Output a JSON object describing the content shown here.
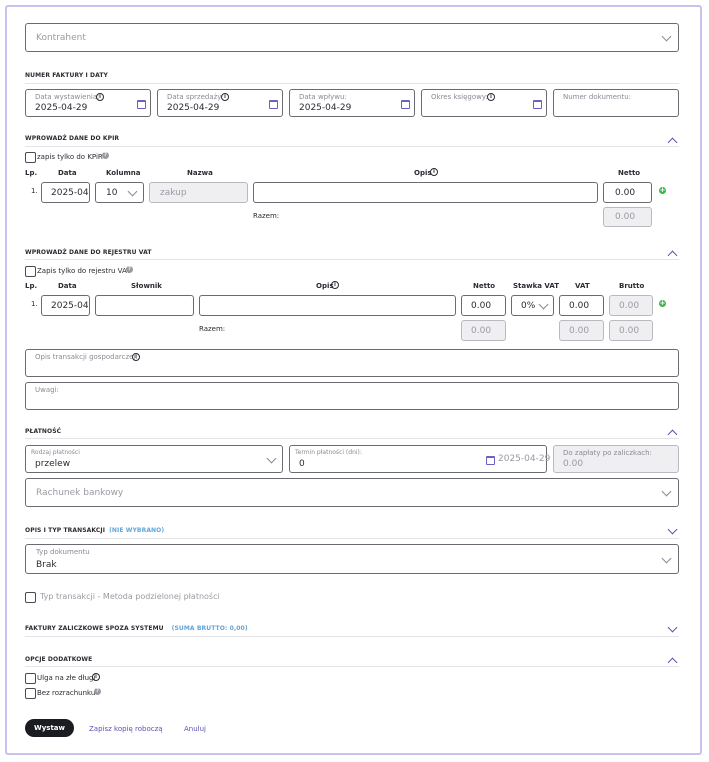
{
  "kontrahent": {
    "placeholder": "Kontrahent"
  },
  "faktura": {
    "section_title": "NUMER FAKTURY I DATY",
    "data_wystawienia": {
      "label": "Data wystawienia:",
      "value": "2025-04-29"
    },
    "data_sprzedazy": {
      "label": "Data sprzedaży:",
      "value": "2025-04-29"
    },
    "data_wplywu": {
      "label": "Data wpływu:",
      "value": "2025-04-29"
    },
    "okres_ksiegowy": {
      "label": "Okres księgowy:",
      "value": ""
    },
    "numer_dokumentu": {
      "label": "Numer dokumentu:",
      "value": ""
    }
  },
  "kpir": {
    "section_title": "WPROWADŹ DANE DO KPIR",
    "checkbox_label": "zapis tylko do KPiR",
    "headers": {
      "lp": "Lp.",
      "data": "Data",
      "kolumna": "Kolumna",
      "nazwa": "Nazwa",
      "opis": "Opis",
      "netto": "Netto"
    },
    "row": {
      "lp": "1.",
      "data": "2025-04",
      "kolumna": "10",
      "nazwa": "zakup",
      "opis": "",
      "netto": "0.00"
    },
    "razem_label": "Razem:",
    "razem_netto": "0.00"
  },
  "vat": {
    "section_title": "WPROWADŹ DANE DO REJESTRU VAT",
    "checkbox_label": "Zapis tylko do rejestru VAT",
    "headers": {
      "lp": "Lp.",
      "data": "Data",
      "slownik": "Słownik",
      "opis": "Opis",
      "netto": "Netto",
      "stawka": "Stawka VAT",
      "vat": "VAT",
      "brutto": "Brutto"
    },
    "row": {
      "lp": "1.",
      "data": "2025-04",
      "slownik": "",
      "opis": "",
      "netto": "0.00",
      "stawka": "0%",
      "vat": "0.00",
      "brutto": "0.00"
    },
    "razem_label": "Razem:",
    "razem_netto": "0.00",
    "razem_vat": "0.00",
    "razem_brutto": "0.00",
    "opis_transakcji_label": "Opis transakcji gospodarczej:",
    "uwagi_label": "Uwagi:"
  },
  "platnosc": {
    "section_title": "PŁATNOŚĆ",
    "rodzaj": {
      "label": "Rodzaj płatności",
      "value": "przelew"
    },
    "termin": {
      "label": "Termin płatności (dni):",
      "value": "0",
      "date": "2025-04-29"
    },
    "do_zaplaty": {
      "label": "Do zapłaty po zaliczkach:",
      "value": "0.00"
    },
    "rachunek_placeholder": "Rachunek bankowy"
  },
  "opis_typ": {
    "section_title": "OPIS I TYP TRANSAKCJI",
    "status_tag": "(NIE WYBRANO)",
    "typ_dokumentu": {
      "label": "Typ dokumentu",
      "value": "Brak"
    },
    "mpp_label": "Typ transakcji - Metoda podzielonej płatności"
  },
  "zaliczkowe": {
    "section_title": "FAKTURY ZALICZKOWE SPOZA SYSTEMU",
    "sum_tag": "(SUMA BRUTTO: 0,00)"
  },
  "opcje": {
    "section_title": "OPCJE DODATKOWE",
    "ulga_label": "Ulga na złe długi",
    "bez_rozrachunku_label": "Bez rozrachunku"
  },
  "actions": {
    "wystaw": "Wystaw",
    "kopia": "Zapisz kopię roboczą",
    "anuluj": "Anuluj"
  },
  "colors": {
    "accent": "#5a55b0",
    "frame": "#c9c2ef",
    "add": "#3bb54a",
    "tag": "#5fa6d8"
  }
}
